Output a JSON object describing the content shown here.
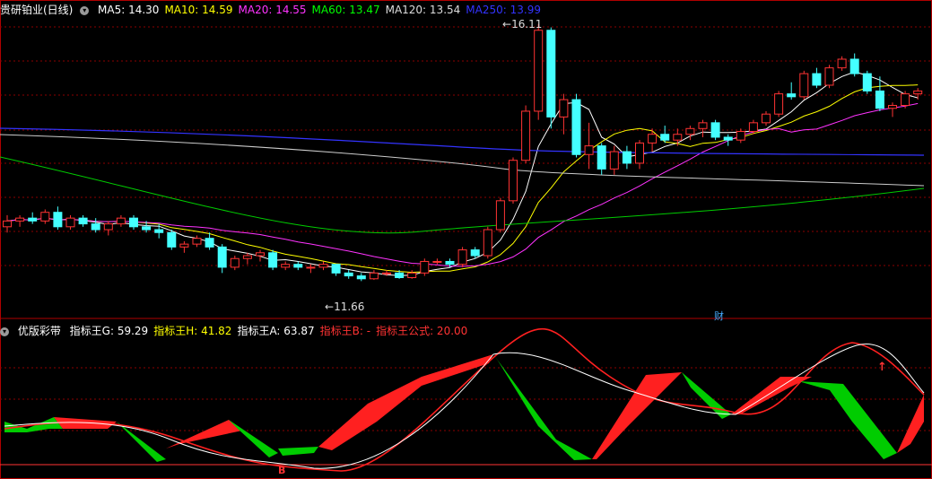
{
  "header": {
    "title": "贵研铂业(日线)",
    "ma": [
      {
        "label": "MA5: 14.30",
        "color": "#ffffff"
      },
      {
        "label": "MA10: 14.59",
        "color": "#ffff00"
      },
      {
        "label": "MA20: 14.55",
        "color": "#ff33ff"
      },
      {
        "label": "MA60: 13.47",
        "color": "#00ff00"
      },
      {
        "label": "MA120: 13.54",
        "color": "#dddddd"
      },
      {
        "label": "MA250: 13.99",
        "color": "#3333ff"
      }
    ]
  },
  "indicator": {
    "name": "优版彩带",
    "items": [
      {
        "label": "指标王G: 59.29",
        "color": "#ffffff"
      },
      {
        "label": "指标王H: 41.82",
        "color": "#ffff00"
      },
      {
        "label": "指标王A: 63.87",
        "color": "#ffffff"
      },
      {
        "label": "指标王B: -",
        "color": "#ff3333"
      },
      {
        "label": "指标王公式: 20.00",
        "color": "#ff3333"
      }
    ],
    "marker_b": "B"
  },
  "annotations": {
    "high": "16.11",
    "low": "11.66",
    "finance_badge": "财"
  },
  "colors": {
    "up": "#ff3333",
    "down": "#44ffff",
    "grid": "#8b0000",
    "ribbon_up": "#ff2020",
    "ribbon_down": "#00cc00"
  },
  "chart_data": {
    "type": "candlestick",
    "price_range": [
      11.2,
      16.4
    ],
    "candles": [
      [
        12.6,
        12.8,
        12.5,
        12.7
      ],
      [
        12.7,
        12.8,
        12.6,
        12.75
      ],
      [
        12.75,
        12.85,
        12.65,
        12.7
      ],
      [
        12.7,
        12.9,
        12.65,
        12.85
      ],
      [
        12.85,
        12.95,
        12.55,
        12.6
      ],
      [
        12.6,
        12.8,
        12.55,
        12.75
      ],
      [
        12.75,
        12.8,
        12.6,
        12.65
      ],
      [
        12.65,
        12.75,
        12.5,
        12.55
      ],
      [
        12.55,
        12.7,
        12.45,
        12.65
      ],
      [
        12.65,
        12.8,
        12.6,
        12.75
      ],
      [
        12.75,
        12.8,
        12.55,
        12.6
      ],
      [
        12.6,
        12.7,
        12.5,
        12.55
      ],
      [
        12.55,
        12.65,
        12.4,
        12.5
      ],
      [
        12.5,
        12.55,
        12.2,
        12.25
      ],
      [
        12.25,
        12.35,
        12.15,
        12.3
      ],
      [
        12.3,
        12.45,
        12.25,
        12.4
      ],
      [
        12.4,
        12.5,
        12.2,
        12.25
      ],
      [
        12.25,
        12.3,
        11.8,
        11.9
      ],
      [
        11.9,
        12.1,
        11.85,
        12.05
      ],
      [
        12.05,
        12.15,
        11.95,
        12.1
      ],
      [
        12.1,
        12.2,
        12.0,
        12.15
      ],
      [
        12.15,
        12.2,
        11.85,
        11.9
      ],
      [
        11.9,
        12.0,
        11.85,
        11.95
      ],
      [
        11.95,
        12.0,
        11.85,
        11.9
      ],
      [
        11.9,
        11.95,
        11.8,
        11.9
      ],
      [
        11.9,
        12.0,
        11.85,
        11.95
      ],
      [
        11.95,
        11.95,
        11.75,
        11.8
      ],
      [
        11.8,
        11.85,
        11.7,
        11.75
      ],
      [
        11.75,
        11.8,
        11.66,
        11.7
      ],
      [
        11.7,
        11.85,
        11.68,
        11.8
      ],
      [
        11.8,
        11.85,
        11.75,
        11.8
      ],
      [
        11.8,
        11.85,
        11.7,
        11.72
      ],
      [
        11.72,
        11.85,
        11.7,
        11.8
      ],
      [
        11.8,
        12.05,
        11.75,
        12.0
      ],
      [
        12.0,
        12.05,
        11.95,
        12.0
      ],
      [
        12.0,
        12.05,
        11.9,
        11.95
      ],
      [
        11.95,
        12.25,
        11.9,
        12.2
      ],
      [
        12.2,
        12.25,
        12.05,
        12.1
      ],
      [
        12.1,
        12.6,
        12.05,
        12.55
      ],
      [
        12.55,
        13.1,
        12.5,
        13.05
      ],
      [
        13.05,
        13.8,
        13.0,
        13.75
      ],
      [
        13.75,
        14.7,
        13.7,
        14.6
      ],
      [
        14.6,
        16.11,
        14.45,
        16.0
      ],
      [
        16.0,
        16.05,
        14.3,
        14.5
      ],
      [
        14.5,
        14.9,
        14.2,
        14.8
      ],
      [
        14.8,
        14.9,
        13.8,
        13.85
      ],
      [
        13.85,
        14.4,
        13.6,
        14.0
      ],
      [
        14.0,
        14.05,
        13.5,
        13.6
      ],
      [
        13.6,
        14.0,
        13.5,
        13.9
      ],
      [
        13.9,
        14.0,
        13.6,
        13.7
      ],
      [
        13.7,
        14.1,
        13.6,
        14.05
      ],
      [
        14.05,
        14.3,
        13.9,
        14.2
      ],
      [
        14.2,
        14.35,
        14.05,
        14.1
      ],
      [
        14.1,
        14.3,
        14.0,
        14.2
      ],
      [
        14.2,
        14.35,
        14.1,
        14.3
      ],
      [
        14.3,
        14.45,
        14.15,
        14.4
      ],
      [
        14.4,
        14.45,
        14.1,
        14.15
      ],
      [
        14.15,
        14.2,
        14.0,
        14.1
      ],
      [
        14.1,
        14.3,
        14.05,
        14.25
      ],
      [
        14.25,
        14.45,
        14.2,
        14.4
      ],
      [
        14.4,
        14.6,
        14.35,
        14.55
      ],
      [
        14.55,
        14.95,
        14.5,
        14.9
      ],
      [
        14.9,
        15.1,
        14.8,
        14.85
      ],
      [
        14.85,
        15.3,
        14.8,
        15.25
      ],
      [
        15.25,
        15.35,
        15.0,
        15.05
      ],
      [
        15.05,
        15.4,
        15.0,
        15.35
      ],
      [
        15.35,
        15.55,
        15.3,
        15.5
      ],
      [
        15.5,
        15.6,
        15.2,
        15.25
      ],
      [
        15.25,
        15.3,
        14.9,
        14.95
      ],
      [
        14.95,
        15.2,
        14.6,
        14.65
      ],
      [
        14.65,
        14.75,
        14.5,
        14.7
      ],
      [
        14.7,
        14.95,
        14.65,
        14.9
      ],
      [
        14.9,
        15.0,
        14.8,
        14.95
      ]
    ]
  }
}
